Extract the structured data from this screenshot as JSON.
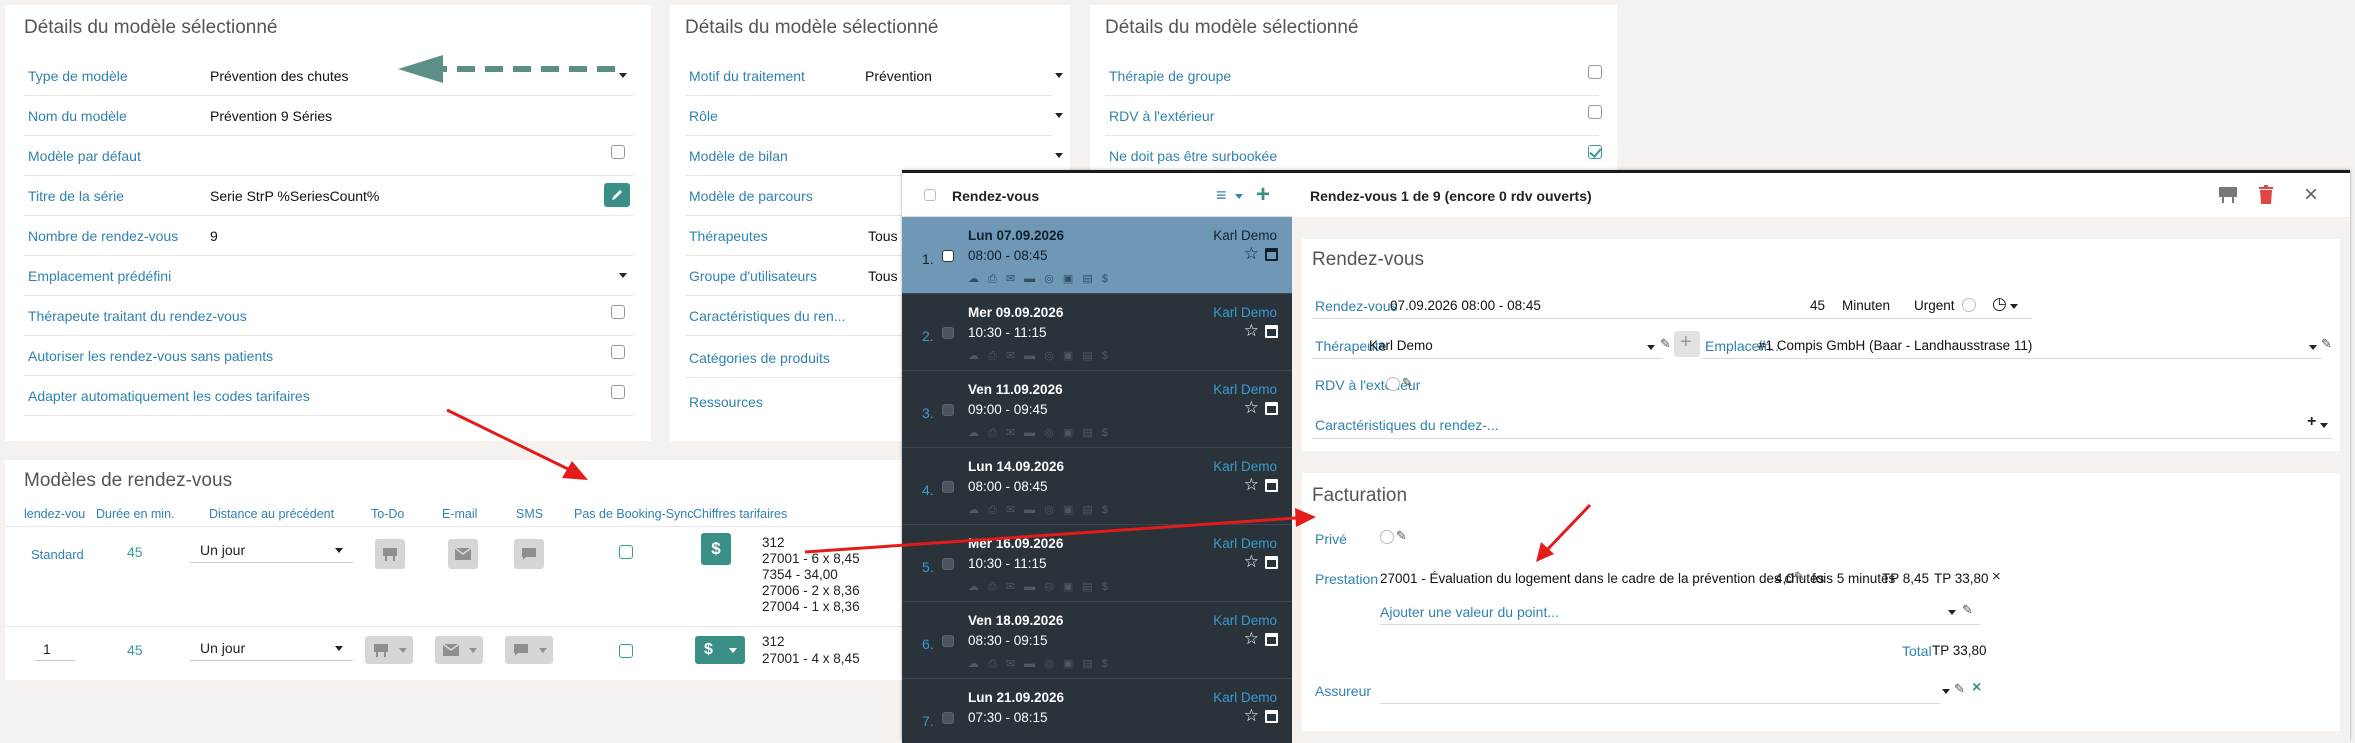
{
  "panel1": {
    "title": "Détails du modèle sélectionné",
    "rows": [
      {
        "label": "Type de modèle",
        "value": "Prévention des chutes"
      },
      {
        "label": "Nom du modèle",
        "value": "Prévention 9 Séries"
      },
      {
        "label": "Modèle par défaut",
        "value": ""
      },
      {
        "label": "Titre de la série",
        "value": "Serie StrP %SeriesCount%"
      },
      {
        "label": "Nombre de rendez-vous",
        "value": "9"
      },
      {
        "label": "Emplacement prédéfini",
        "value": ""
      },
      {
        "label": "Thérapeute traitant du rendez-vous",
        "value": ""
      },
      {
        "label": "Autoriser les rendez-vous sans patients",
        "value": ""
      },
      {
        "label": "Adapter automatiquement les codes tarifaires",
        "value": ""
      }
    ]
  },
  "panel2": {
    "title": "Détails du modèle sélectionné",
    "rows": [
      {
        "label": "Motif du traitement",
        "value": "Prévention"
      },
      {
        "label": "Rôle",
        "value": ""
      },
      {
        "label": "Modèle de bilan",
        "value": ""
      },
      {
        "label": "Modèle de parcours",
        "value": ""
      },
      {
        "label": "Thérapeutes",
        "value": "Tous"
      },
      {
        "label": "Groupe d'utilisateurs",
        "value": "Tous"
      },
      {
        "label": "Caractéristiques du ren...",
        "value": ""
      },
      {
        "label": "Catégories de produits",
        "value": ""
      },
      {
        "label": "Ressources",
        "value": ""
      }
    ]
  },
  "panel3": {
    "title": "Détails du modèle sélectionné",
    "rows": [
      {
        "label": "Thérapie de groupe",
        "checked": false
      },
      {
        "label": "RDV  à l'extérieur",
        "checked": false
      },
      {
        "label": "Ne doit pas être surbookée",
        "checked": true
      }
    ]
  },
  "templates": {
    "title": "Modèles de rendez-vous",
    "headers": [
      "lendez-vou",
      "Durée en min.",
      "Distance au précédent",
      "To-Do",
      "E-mail",
      "SMS",
      "Pas de Booking-Sync",
      "Chiffres tarifaires"
    ],
    "rows": [
      {
        "name": "Standard",
        "duration": "45",
        "distance": "Un jour",
        "tariffs": [
          "312",
          "27001 - 6 x 8,45",
          "7354 - 34,00",
          "27006 - 2 x 8,36",
          "27004 - 1 x 8,36"
        ]
      },
      {
        "name": "1",
        "duration": "45",
        "distance": "Un jour",
        "tariffs": [
          "312",
          "27001 - 4 x 8,45"
        ]
      }
    ]
  },
  "list": {
    "header": "Rendez-vous",
    "items": [
      {
        "num": "1.",
        "date": "Lun 07.09.2026",
        "time": "08:00 - 08:45",
        "who": "Karl Demo",
        "selected": true
      },
      {
        "num": "2.",
        "date": "Mer 09.09.2026",
        "time": "10:30 - 11:15",
        "who": "Karl Demo"
      },
      {
        "num": "3.",
        "date": "Ven 11.09.2026",
        "time": "09:00 - 09:45",
        "who": "Karl Demo"
      },
      {
        "num": "4.",
        "date": "Lun 14.09.2026",
        "time": "08:00 - 08:45",
        "who": "Karl Demo"
      },
      {
        "num": "5.",
        "date": "Mer 16.09.2026",
        "time": "10:30 - 11:15",
        "who": "Karl Demo"
      },
      {
        "num": "6.",
        "date": "Ven 18.09.2026",
        "time": "08:30 - 09:15",
        "who": "Karl Demo"
      },
      {
        "num": "7.",
        "date": "Lun 21.09.2026",
        "time": "07:30 - 08:15",
        "who": "Karl Demo"
      }
    ]
  },
  "detail": {
    "header": "Rendez-vous 1 de 9 (encore 0 rdv ouverts)",
    "rdv_title": "Rendez-vous",
    "rdv_label": "Rendez-vous",
    "rdv_value": "07.09.2026 08:00 - 08:45",
    "duration": "45",
    "minutes": "Minuten",
    "urgent": "Urgent",
    "therapist_label": "Thérapeute",
    "therapist_value": "Karl Demo",
    "location_label": "Emplacem...",
    "location_value": "#1 Compis GmbH (Baar - Landhausstrase 11)",
    "ext_label": "RDV à l'extérieur",
    "char_label": "Caractéristiques du rendez-...",
    "fact_title": "Facturation",
    "prive_label": "Privé",
    "prest_label": "Prestation",
    "prest_value": "27001 - Évaluation du logement dans le cadre de la prévention des chutes",
    "prest_qty": "4,0",
    "prest_fois": "fois 5 minutes",
    "prest_tp": "TP 8,45",
    "prest_total": "TP 33,80",
    "add_point": "Ajouter une valeur du point...",
    "total_label": "Total",
    "total_value": "TP 33,80",
    "assureur_label": "Assureur"
  },
  "colors": {
    "accent": "#3a8f86",
    "label": "#2f82b0",
    "arrow": "#e31b1b"
  }
}
